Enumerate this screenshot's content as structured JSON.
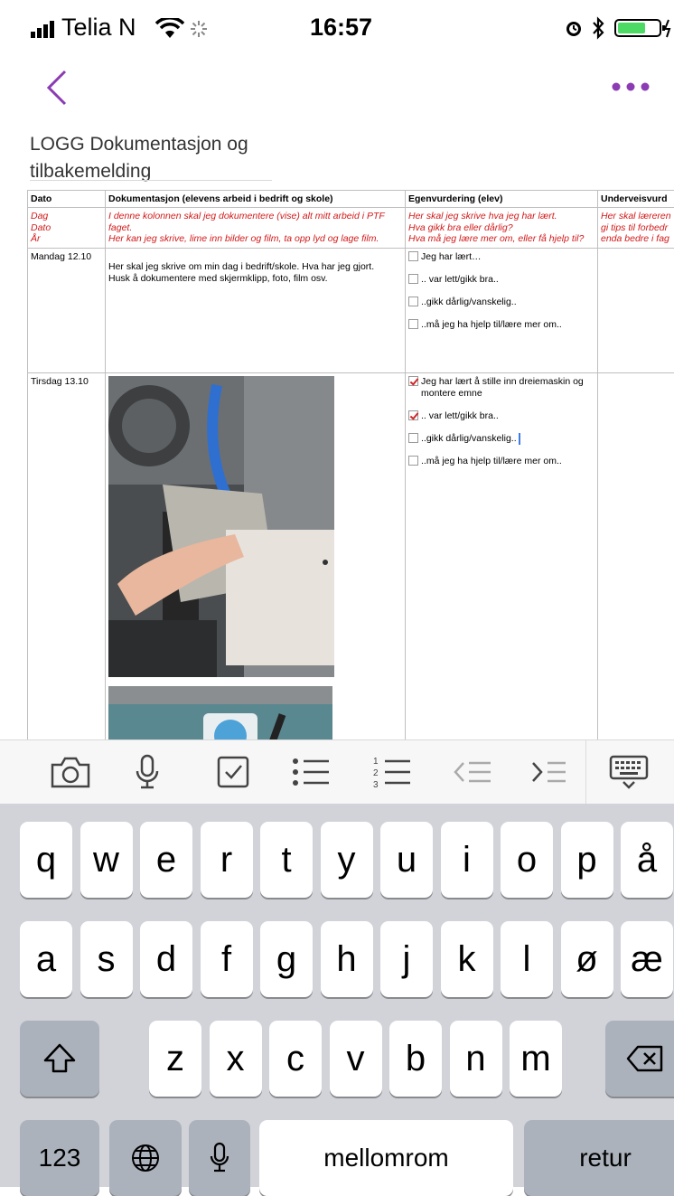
{
  "status_bar": {
    "carrier": "Telia N",
    "time": "16:57"
  },
  "page": {
    "title": "LOGG Dokumentasjon og tilbakemelding"
  },
  "table": {
    "headers": [
      "Dato",
      "Dokumentasjon (elevens arbeid i bedrift og skole)",
      "Egenvurdering (elev)",
      "Underveisvurd"
    ],
    "instructions": {
      "dato": [
        "Dag",
        "Dato",
        "År"
      ],
      "dokumentasjon": [
        "I denne kolonnen skal jeg dokumentere (vise) alt mitt arbeid i PTF",
        "faget.",
        "Her kan jeg skrive, lime inn bilder og film, ta opp lyd og lage film."
      ],
      "egenvurdering": [
        "Her skal jeg skrive hva jeg har lært.",
        "Hva gikk bra eller dårlig?",
        "Hva må jeg lære mer om, eller få hjelp til?"
      ],
      "underveis": [
        "Her skal læreren",
        "gi tips til forbedr",
        "enda bedre i fag"
      ]
    },
    "rows": [
      {
        "date": "Mandag 12.10",
        "documentation": [
          "Her skal jeg skrive om min dag i bedrift/skole. Hva har jeg gjort.",
          "Husk å dokumentere med skjermklipp, foto, film osv."
        ],
        "checks": [
          {
            "label": "Jeg har lært…",
            "checked": false
          },
          {
            "label": ".. var lett/gikk bra..",
            "checked": false
          },
          {
            "label": "..gikk dårlig/vanskelig..",
            "checked": false
          },
          {
            "label": "..må jeg ha hjelp til/lære mer om..",
            "checked": false
          }
        ]
      },
      {
        "date": "Tirsdag 13.10",
        "checks": [
          {
            "label": "Jeg har lært å stille inn dreiemaskin og montere emne",
            "checked": true
          },
          {
            "label": ".. var lett/gikk bra..",
            "checked": true
          },
          {
            "label": "..gikk dårlig/vanskelig..",
            "checked": false
          },
          {
            "label": "..må jeg ha hjelp til/lære mer om..",
            "checked": false
          }
        ]
      }
    ]
  },
  "toolbar": {
    "icons": [
      "camera-icon",
      "microphone-icon",
      "checkbox-icon",
      "bullet-list-icon",
      "numbered-list-icon",
      "outdent-icon",
      "indent-icon",
      "keyboard-dismiss-icon"
    ]
  },
  "keyboard": {
    "row1": [
      "q",
      "w",
      "e",
      "r",
      "t",
      "y",
      "u",
      "i",
      "o",
      "p",
      "å"
    ],
    "row2": [
      "a",
      "s",
      "d",
      "f",
      "g",
      "h",
      "j",
      "k",
      "l",
      "ø",
      "æ"
    ],
    "row3": [
      "z",
      "x",
      "c",
      "v",
      "b",
      "n",
      "m"
    ],
    "numbers_label": "123",
    "space_label": "mellomrom",
    "return_label": "retur"
  },
  "colors": {
    "accent": "#8b3bb3",
    "instruction_red": "#d21818",
    "keyboard_bg": "#d1d3d9"
  }
}
